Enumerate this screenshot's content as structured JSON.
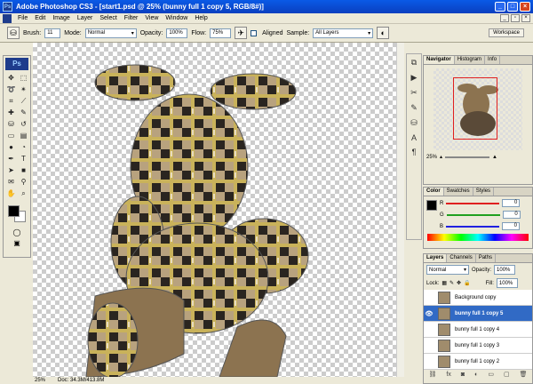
{
  "window": {
    "title": "Adobe Photoshop CS3 - [start1.psd @ 25% (bunny full 1 copy 5, RGB/8#)]"
  },
  "menu": [
    "File",
    "Edit",
    "Image",
    "Layer",
    "Select",
    "Filter",
    "View",
    "Window",
    "Help"
  ],
  "options": {
    "brush_label": "Brush:",
    "brush_size": "11",
    "mode_label": "Mode:",
    "mode_value": "Normal",
    "opacity_label": "Opacity:",
    "opacity_value": "100%",
    "flow_label": "Flow:",
    "flow_value": "75%",
    "aligned_label": "Aligned",
    "sample_label": "Sample:",
    "sample_value": "All Layers",
    "workspace_label": "Workspace"
  },
  "toolbox": {
    "logo": "Ps",
    "tools": [
      "move-icon",
      "marquee-icon",
      "lasso-icon",
      "magic-wand-icon",
      "crop-icon",
      "slice-icon",
      "healing-brush-icon",
      "brush-icon",
      "clone-stamp-icon",
      "history-brush-icon",
      "eraser-icon",
      "gradient-icon",
      "blur-icon",
      "dodge-icon",
      "pen-icon",
      "type-icon",
      "path-selection-icon",
      "shape-icon",
      "notes-icon",
      "eyedropper-icon",
      "hand-icon",
      "zoom-icon"
    ]
  },
  "canvas": {
    "colors": {
      "body": "#b8a27e",
      "dark": "#2a2520",
      "light": "#e8dcc0",
      "stripe": "#c9b25a"
    }
  },
  "status": {
    "zoom": "25%",
    "doc": "Doc: 34.3M/413.8M"
  },
  "navigator": {
    "tabs": [
      "Navigator",
      "Histogram",
      "Info"
    ],
    "zoom": "25%"
  },
  "color": {
    "tabs": [
      "Color",
      "Swatches",
      "Styles"
    ],
    "rows": [
      {
        "label": "R",
        "value": "0",
        "color": "#e02020"
      },
      {
        "label": "G",
        "value": "0",
        "color": "#20a020"
      },
      {
        "label": "B",
        "value": "0",
        "color": "#2020e0"
      }
    ]
  },
  "layers": {
    "tabs": [
      "Layers",
      "Channels",
      "Paths"
    ],
    "blend_mode": "Normal",
    "opacity_label": "Opacity:",
    "opacity_value": "100%",
    "lock_label": "Lock:",
    "fill_label": "Fill:",
    "fill_value": "100%",
    "items": [
      {
        "name": "Background copy",
        "visible": false,
        "selected": false
      },
      {
        "name": "bunny full 1 copy 5",
        "visible": true,
        "selected": true
      },
      {
        "name": "bunny full 1 copy 4",
        "visible": false,
        "selected": false
      },
      {
        "name": "bunny full 1 copy 3",
        "visible": false,
        "selected": false
      },
      {
        "name": "bunny full 1 copy 2",
        "visible": false,
        "selected": false
      }
    ]
  }
}
